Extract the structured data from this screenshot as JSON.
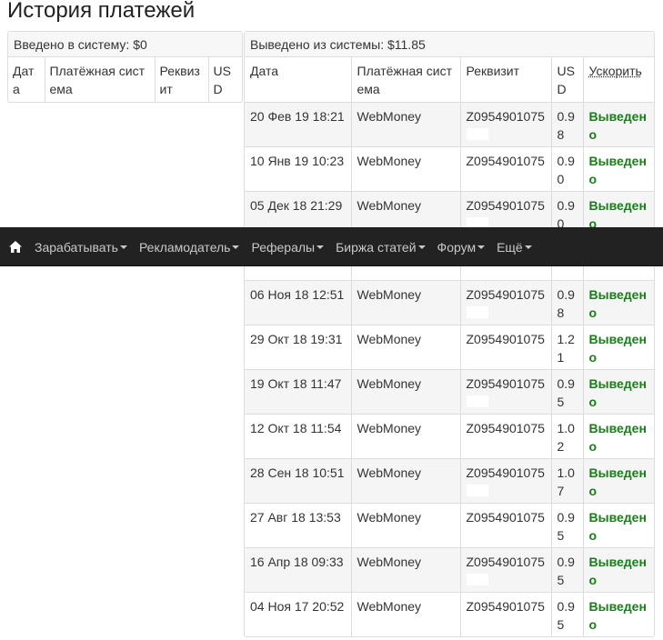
{
  "page": {
    "title": "История платежей"
  },
  "deposits": {
    "heading": "Введено в систему: $0",
    "columns": [
      "Дата",
      "Платёжная система",
      "Реквизит",
      "USD"
    ]
  },
  "withdrawals": {
    "heading": "Выведено из системы: $11.85",
    "columns": [
      "Дата",
      "Платёжная система",
      "Реквизит",
      "USD",
      "Ускорить"
    ],
    "rows": [
      {
        "date": "20 Фев 19 18:21",
        "system": "WebMoney",
        "rekv": "Z0954901075",
        "usd": "0.98",
        "status": "Выведено"
      },
      {
        "date": "10 Янв 19 10:23",
        "system": "WebMoney",
        "rekv": "Z0954901075",
        "usd": "0.90",
        "status": "Выведено"
      },
      {
        "date": "05 Дек 18 21:29",
        "system": "WebMoney",
        "rekv": "Z0954901075",
        "usd": "0.90",
        "status": "Выведено"
      },
      {
        "date": "",
        "system": "",
        "rekv": "",
        "usd": "9",
        "status": "но"
      },
      {
        "date": "06 Ноя 18 12:51",
        "system": "WebMoney",
        "rekv": "Z0954901075",
        "usd": "0.98",
        "status": "Выведено"
      },
      {
        "date": "29 Окт 18 19:31",
        "system": "WebMoney",
        "rekv": "Z0954901075",
        "usd": "1.21",
        "status": "Выведено"
      },
      {
        "date": "19 Окт 18 11:47",
        "system": "WebMoney",
        "rekv": "Z0954901075",
        "usd": "0.95",
        "status": "Выведено"
      },
      {
        "date": "12 Окт 18 11:54",
        "system": "WebMoney",
        "rekv": "Z0954901075",
        "usd": "1.02",
        "status": "Выведено"
      },
      {
        "date": "28 Сен 18 10:51",
        "system": "WebMoney",
        "rekv": "Z0954901075",
        "usd": "1.07",
        "status": "Выведено"
      },
      {
        "date": "27 Авг 18 13:53",
        "system": "WebMoney",
        "rekv": "Z0954901075",
        "usd": "0.95",
        "status": "Выведено"
      },
      {
        "date": "16 Апр 18 09:33",
        "system": "WebMoney",
        "rekv": "Z0954901075",
        "usd": "0.95",
        "status": "Выведено"
      },
      {
        "date": "04 Ноя 17 20:52",
        "system": "WebMoney",
        "rekv": "Z0954901075",
        "usd": "0.95",
        "status": "Выведено"
      }
    ]
  },
  "navbar": {
    "home_icon": "home-icon",
    "items": [
      {
        "label": "Зарабатывать"
      },
      {
        "label": "Рекламодатель"
      },
      {
        "label": "Рефералы"
      },
      {
        "label": "Биржа статей"
      },
      {
        "label": "Форум"
      },
      {
        "label": "Ещё"
      }
    ]
  },
  "colors": {
    "status_green": "#1a7d1a",
    "navbar_bg": "#222222",
    "stripe": "#f5f5f5"
  }
}
